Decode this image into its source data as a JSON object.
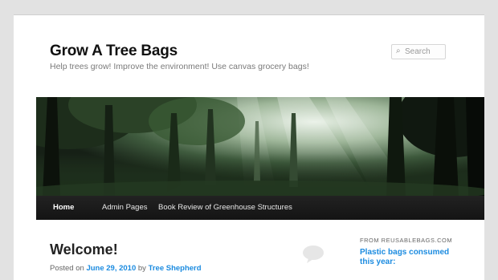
{
  "header": {
    "site_title": "Grow A Tree Bags",
    "site_description": "Help trees grow! Improve the environment! Use canvas grocery bags!",
    "search_placeholder": "Search"
  },
  "nav": {
    "items": [
      {
        "label": "Home",
        "active": true
      },
      {
        "label": "Admin Pages",
        "active": false
      },
      {
        "label": "Book Review of Greenhouse Structures",
        "active": false
      }
    ]
  },
  "post": {
    "title": "Welcome!",
    "meta_prefix": "Posted on",
    "date": "June 29, 2010",
    "meta_by": "by",
    "author": "Tree Shepherd"
  },
  "sidebar": {
    "widget_label": "FROM REUSABLEBAGS.COM",
    "widget_text": "Plastic bags consumed this year:"
  },
  "colors": {
    "link": "#1b8be0",
    "nav_bg": "#1a1a1a",
    "title": "#111111"
  }
}
